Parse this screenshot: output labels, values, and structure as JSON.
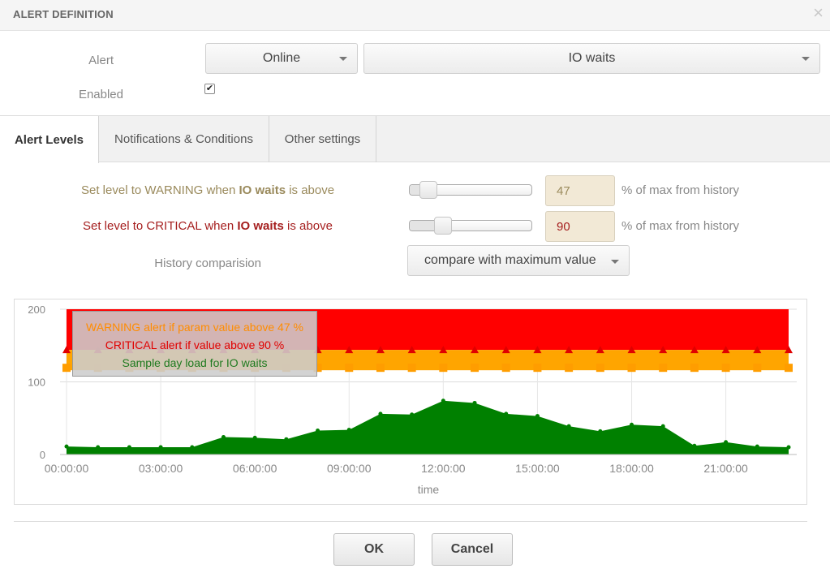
{
  "dialog": {
    "title": "ALERT DEFINITION",
    "close_glyph": "×"
  },
  "form": {
    "alert_label": "Alert",
    "enabled_label": "Enabled",
    "enabled_checked": true,
    "source_select": "Online",
    "metric_select": "IO waits"
  },
  "tabs": [
    {
      "label": "Alert Levels",
      "active": true
    },
    {
      "label": "Notifications & Conditions",
      "active": false
    },
    {
      "label": "Other settings",
      "active": false
    }
  ],
  "levels": {
    "warning": {
      "prefix": "Set level to WARNING when ",
      "metric": "IO waits",
      "suffix": " is above",
      "value": "47",
      "unit": "% of max from history",
      "slider_fraction": 0.09
    },
    "critical": {
      "prefix": "Set level to CRITICAL when ",
      "metric": "IO waits",
      "suffix": " is above",
      "value": "90",
      "unit": "% of max from history",
      "slider_fraction": 0.23
    },
    "history_label": "History comparision",
    "history_select": "compare with maximum value"
  },
  "legend": {
    "warning": "WARNING alert if param value above 47 %",
    "critical": "CRITICAL alert if value above 90 %",
    "sample": "Sample day load for IO waits"
  },
  "chart_data": {
    "type": "area",
    "xlabel": "time",
    "ylim": [
      0,
      200
    ],
    "yticks": [
      "200",
      "100",
      "0"
    ],
    "xticks": [
      "00:00:00",
      "03:00:00",
      "06:00:00",
      "09:00:00",
      "12:00:00",
      "15:00:00",
      "18:00:00",
      "21:00:00"
    ],
    "x": [
      "00:00",
      "01:00",
      "02:00",
      "03:00",
      "04:00",
      "05:00",
      "06:00",
      "07:00",
      "08:00",
      "09:00",
      "10:00",
      "11:00",
      "12:00",
      "13:00",
      "14:00",
      "15:00",
      "16:00",
      "17:00",
      "18:00",
      "19:00",
      "20:00",
      "21:00",
      "22:00",
      "23:00"
    ],
    "series": [
      {
        "name": "Sample day load for IO waits",
        "color": "#008000",
        "values": [
          11,
          10,
          10,
          10,
          10,
          24,
          23,
          21,
          33,
          34,
          56,
          55,
          74,
          71,
          56,
          53,
          39,
          32,
          41,
          39,
          12,
          17,
          11,
          10
        ]
      },
      {
        "name": "WARNING alert if param value above 47 %",
        "color": "#ffa500",
        "values": [
          130
        ]
      },
      {
        "name": "CRITICAL alert if value above 90 %",
        "color": "#ff0000",
        "values": [
          200
        ]
      }
    ],
    "warning_band": [
      116,
      144
    ],
    "critical_band": [
      144,
      200
    ]
  },
  "footer": {
    "ok_label": "OK",
    "cancel_label": "Cancel"
  },
  "colors": {
    "warning": "#ffa500",
    "critical": "#ff0000",
    "load": "#008000"
  }
}
